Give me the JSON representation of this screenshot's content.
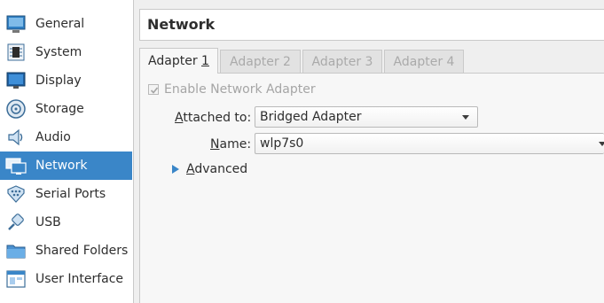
{
  "sidebar": {
    "items": [
      {
        "label": "General",
        "icon": "general-icon"
      },
      {
        "label": "System",
        "icon": "system-icon"
      },
      {
        "label": "Display",
        "icon": "display-icon"
      },
      {
        "label": "Storage",
        "icon": "storage-icon"
      },
      {
        "label": "Audio",
        "icon": "audio-icon"
      },
      {
        "label": "Network",
        "icon": "network-icon",
        "selected": true
      },
      {
        "label": "Serial Ports",
        "icon": "serial-ports-icon"
      },
      {
        "label": "USB",
        "icon": "usb-icon"
      },
      {
        "label": "Shared Folders",
        "icon": "shared-folders-icon"
      },
      {
        "label": "User Interface",
        "icon": "user-interface-icon"
      }
    ]
  },
  "header": {
    "title": "Network"
  },
  "tabs": [
    {
      "label": "Adapter",
      "num": "1",
      "active": true
    },
    {
      "label": "Adapter",
      "num": "2",
      "active": false
    },
    {
      "label": "Adapter",
      "num": "3",
      "active": false
    },
    {
      "label": "Adapter",
      "num": "4",
      "active": false
    }
  ],
  "adapter": {
    "enable": {
      "label": "Enable Network Adapter",
      "checked": true,
      "enabled": false
    },
    "attached_to": {
      "label_prefix": "A",
      "label_rest": "ttached to:",
      "value": "Bridged Adapter"
    },
    "name": {
      "label_prefix": "N",
      "label_rest": "ame:",
      "value": "wlp7s0"
    },
    "advanced": {
      "label_prefix": "A",
      "label_rest": "dvanced"
    }
  },
  "colors": {
    "selection": "#3a86c8",
    "accent_arrow": "#3a86c8"
  }
}
